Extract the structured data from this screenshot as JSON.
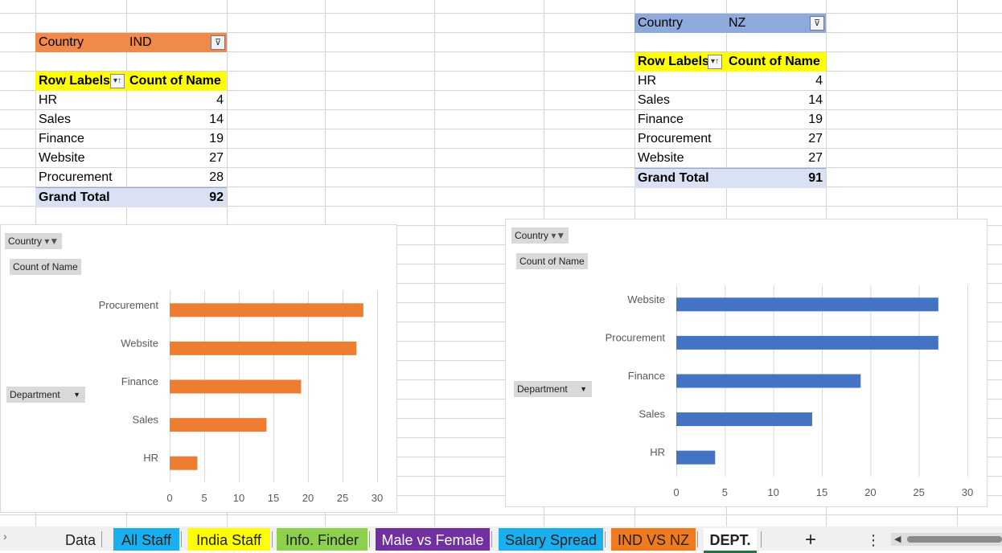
{
  "pivot_ind": {
    "filter_label": "Country",
    "filter_value": "IND",
    "header_row_labels": "Row Labels",
    "header_count": "Count of Name",
    "rows": [
      {
        "label": "HR",
        "value": "4"
      },
      {
        "label": "Sales",
        "value": "14"
      },
      {
        "label": "Finance",
        "value": "19"
      },
      {
        "label": "Website",
        "value": "27"
      },
      {
        "label": "Procurement",
        "value": "28"
      }
    ],
    "total_label": "Grand Total",
    "total_value": "92",
    "header_color": "#f08a4b"
  },
  "pivot_nz": {
    "filter_label": "Country",
    "filter_value": "NZ",
    "header_row_labels": "Row Labels",
    "header_count": "Count of Name",
    "rows": [
      {
        "label": "HR",
        "value": "4"
      },
      {
        "label": "Sales",
        "value": "14"
      },
      {
        "label": "Finance",
        "value": "19"
      },
      {
        "label": "Procurement",
        "value": "27"
      },
      {
        "label": "Website",
        "value": "27"
      }
    ],
    "total_label": "Grand Total",
    "total_value": "91",
    "header_color": "#8eaadb"
  },
  "chart_left": {
    "country_button": "Country",
    "count_button": "Count of Name",
    "axis_button": "Department"
  },
  "chart_right": {
    "country_button": "Country",
    "count_button": "Count of Name",
    "axis_button": "Department"
  },
  "chart_data": [
    {
      "type": "bar",
      "orientation": "horizontal",
      "categories": [
        "Procurement",
        "Website",
        "Finance",
        "Sales",
        "HR"
      ],
      "values": [
        28,
        27,
        19,
        14,
        4
      ],
      "xlim": [
        0,
        30
      ],
      "ticks": [
        0,
        5,
        10,
        15,
        20,
        25,
        30
      ],
      "grid": true,
      "color": "#ed7d31"
    },
    {
      "type": "bar",
      "orientation": "horizontal",
      "categories": [
        "Website",
        "Procurement",
        "Finance",
        "Sales",
        "HR"
      ],
      "values": [
        27,
        27,
        19,
        14,
        4
      ],
      "xlim": [
        0,
        30
      ],
      "ticks": [
        0,
        5,
        10,
        15,
        20,
        25,
        30
      ],
      "grid": true,
      "color": "#4472c4"
    }
  ],
  "sheet_tabs": [
    {
      "label": "Data",
      "color": "#f0f0f0"
    },
    {
      "label": "All Staff",
      "color": "#1ab0f0"
    },
    {
      "label": "India Staff",
      "color": "#ffff00"
    },
    {
      "label": "Info. Finder",
      "color": "#8dd04e"
    },
    {
      "label": "Male vs Female",
      "color": "#7030a0"
    },
    {
      "label": "Salary Spread",
      "color": "#1ab0f0"
    },
    {
      "label": "IND VS NZ",
      "color": "#f07a1e"
    },
    {
      "label": "DEPT.",
      "color": "#ffffff"
    }
  ],
  "add_sheet": "+",
  "more": "⋮",
  "colors": {
    "highlight_yellow": "#ffff00",
    "total_blue": "#d9e1f2"
  }
}
